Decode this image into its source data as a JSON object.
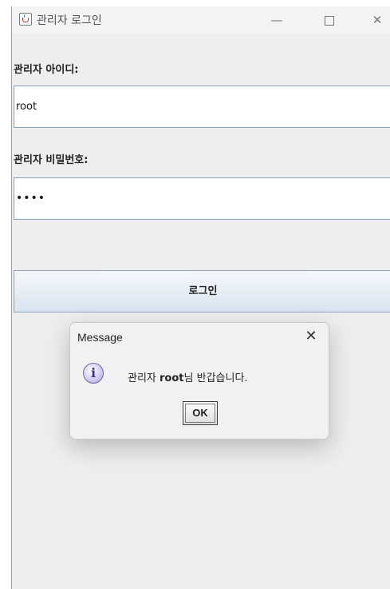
{
  "window": {
    "title": "관리자 로그인",
    "controls": {
      "minimize": "—",
      "close": "✕"
    }
  },
  "form": {
    "id_label": "관리자 아이디:",
    "id_value": "root",
    "pw_label": "관리자 비밀번호:",
    "pw_masked": "••••",
    "login_button": "로그인"
  },
  "dialog": {
    "title": "Message",
    "close": "✕",
    "icon": "info-icon",
    "icon_glyph": "i",
    "message_prefix": "관리자 ",
    "message_user": "root",
    "message_suffix": "님 반갑습니다.",
    "ok_button": "OK"
  }
}
